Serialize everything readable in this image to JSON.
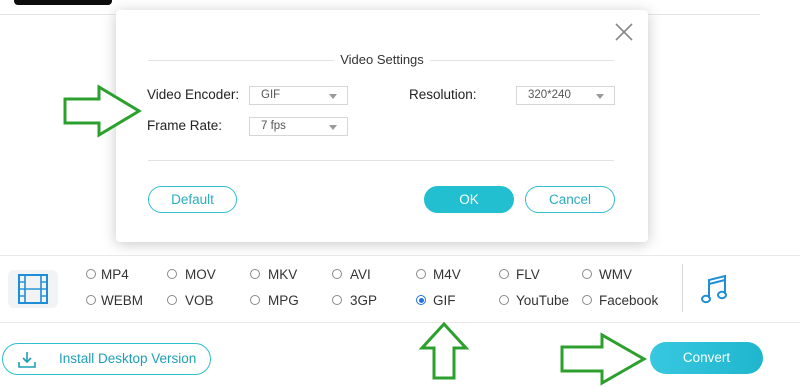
{
  "dialog": {
    "title": "Video Settings",
    "encoder_label": "Video Encoder:",
    "encoder_value": "GIF",
    "framerate_label": "Frame Rate:",
    "framerate_value": "7 fps",
    "resolution_label": "Resolution:",
    "resolution_value": "320*240",
    "default_label": "Default",
    "ok_label": "OK",
    "cancel_label": "Cancel"
  },
  "formats": {
    "row1": [
      "MP4",
      "MOV",
      "MKV",
      "AVI",
      "M4V",
      "FLV",
      "WMV"
    ],
    "row2": [
      "WEBM",
      "VOB",
      "MPG",
      "3GP",
      "GIF",
      "YouTube",
      "Facebook"
    ],
    "selected": "GIF"
  },
  "footer": {
    "install_label": "Install Desktop Version",
    "convert_label": "Convert"
  },
  "colors": {
    "accent": "#22bfd0",
    "arrow": "#2ca02c",
    "radio_selected": "#1f73e8"
  }
}
